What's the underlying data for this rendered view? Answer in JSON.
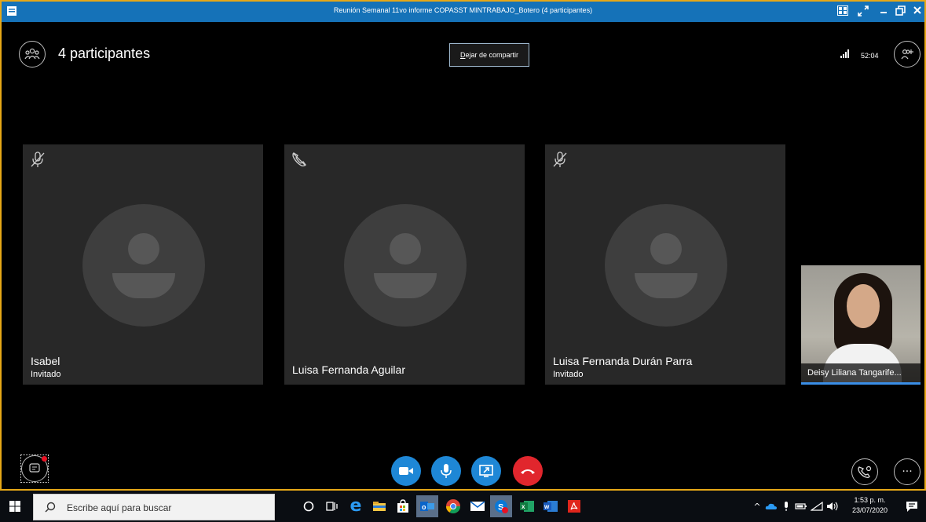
{
  "window": {
    "title": "Reunión Semanal 11vo informe COPASST MINTRABAJO_Botero (4 participantes)"
  },
  "header": {
    "participants_label": "4 participantes",
    "stop_sharing_key": "D",
    "stop_sharing_rest": "ejar de compartir",
    "call_timer": "52:04"
  },
  "participants": [
    {
      "name": "Isabel",
      "role": "Invitado",
      "mic_icon": "mic-muted-icon"
    },
    {
      "name": "Luisa Fernanda Aguilar",
      "role": "",
      "mic_icon": "phone-muted-icon"
    },
    {
      "name": "Luisa Fernanda Durán Parra",
      "role": "Invitado",
      "mic_icon": "mic-muted-icon"
    }
  ],
  "self_view": {
    "caption": "Deisy Liliana Tangarife..."
  },
  "controls": {
    "video_color": "#1e87d6",
    "mic_color": "#1e87d6",
    "share_color": "#1e87d6",
    "hangup_color": "#e1262d"
  },
  "taskbar": {
    "search_placeholder": "Escribe aquí para buscar",
    "time": "1:53 p. m.",
    "date": "23/07/2020"
  },
  "colors": {
    "titlebar": "#1572b8",
    "frame_border": "#e6a817",
    "tile_bg": "#282828"
  }
}
